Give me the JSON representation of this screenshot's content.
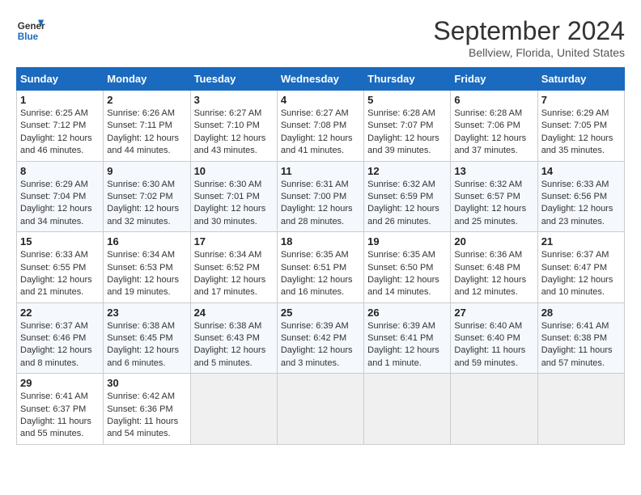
{
  "header": {
    "logo_line1": "General",
    "logo_line2": "Blue",
    "month_title": "September 2024",
    "subtitle": "Bellview, Florida, United States"
  },
  "days_of_week": [
    "Sunday",
    "Monday",
    "Tuesday",
    "Wednesday",
    "Thursday",
    "Friday",
    "Saturday"
  ],
  "weeks": [
    [
      {
        "day": "1",
        "info": "Sunrise: 6:25 AM\nSunset: 7:12 PM\nDaylight: 12 hours and 46 minutes."
      },
      {
        "day": "2",
        "info": "Sunrise: 6:26 AM\nSunset: 7:11 PM\nDaylight: 12 hours and 44 minutes."
      },
      {
        "day": "3",
        "info": "Sunrise: 6:27 AM\nSunset: 7:10 PM\nDaylight: 12 hours and 43 minutes."
      },
      {
        "day": "4",
        "info": "Sunrise: 6:27 AM\nSunset: 7:08 PM\nDaylight: 12 hours and 41 minutes."
      },
      {
        "day": "5",
        "info": "Sunrise: 6:28 AM\nSunset: 7:07 PM\nDaylight: 12 hours and 39 minutes."
      },
      {
        "day": "6",
        "info": "Sunrise: 6:28 AM\nSunset: 7:06 PM\nDaylight: 12 hours and 37 minutes."
      },
      {
        "day": "7",
        "info": "Sunrise: 6:29 AM\nSunset: 7:05 PM\nDaylight: 12 hours and 35 minutes."
      }
    ],
    [
      {
        "day": "8",
        "info": "Sunrise: 6:29 AM\nSunset: 7:04 PM\nDaylight: 12 hours and 34 minutes."
      },
      {
        "day": "9",
        "info": "Sunrise: 6:30 AM\nSunset: 7:02 PM\nDaylight: 12 hours and 32 minutes."
      },
      {
        "day": "10",
        "info": "Sunrise: 6:30 AM\nSunset: 7:01 PM\nDaylight: 12 hours and 30 minutes."
      },
      {
        "day": "11",
        "info": "Sunrise: 6:31 AM\nSunset: 7:00 PM\nDaylight: 12 hours and 28 minutes."
      },
      {
        "day": "12",
        "info": "Sunrise: 6:32 AM\nSunset: 6:59 PM\nDaylight: 12 hours and 26 minutes."
      },
      {
        "day": "13",
        "info": "Sunrise: 6:32 AM\nSunset: 6:57 PM\nDaylight: 12 hours and 25 minutes."
      },
      {
        "day": "14",
        "info": "Sunrise: 6:33 AM\nSunset: 6:56 PM\nDaylight: 12 hours and 23 minutes."
      }
    ],
    [
      {
        "day": "15",
        "info": "Sunrise: 6:33 AM\nSunset: 6:55 PM\nDaylight: 12 hours and 21 minutes."
      },
      {
        "day": "16",
        "info": "Sunrise: 6:34 AM\nSunset: 6:53 PM\nDaylight: 12 hours and 19 minutes."
      },
      {
        "day": "17",
        "info": "Sunrise: 6:34 AM\nSunset: 6:52 PM\nDaylight: 12 hours and 17 minutes."
      },
      {
        "day": "18",
        "info": "Sunrise: 6:35 AM\nSunset: 6:51 PM\nDaylight: 12 hours and 16 minutes."
      },
      {
        "day": "19",
        "info": "Sunrise: 6:35 AM\nSunset: 6:50 PM\nDaylight: 12 hours and 14 minutes."
      },
      {
        "day": "20",
        "info": "Sunrise: 6:36 AM\nSunset: 6:48 PM\nDaylight: 12 hours and 12 minutes."
      },
      {
        "day": "21",
        "info": "Sunrise: 6:37 AM\nSunset: 6:47 PM\nDaylight: 12 hours and 10 minutes."
      }
    ],
    [
      {
        "day": "22",
        "info": "Sunrise: 6:37 AM\nSunset: 6:46 PM\nDaylight: 12 hours and 8 minutes."
      },
      {
        "day": "23",
        "info": "Sunrise: 6:38 AM\nSunset: 6:45 PM\nDaylight: 12 hours and 6 minutes."
      },
      {
        "day": "24",
        "info": "Sunrise: 6:38 AM\nSunset: 6:43 PM\nDaylight: 12 hours and 5 minutes."
      },
      {
        "day": "25",
        "info": "Sunrise: 6:39 AM\nSunset: 6:42 PM\nDaylight: 12 hours and 3 minutes."
      },
      {
        "day": "26",
        "info": "Sunrise: 6:39 AM\nSunset: 6:41 PM\nDaylight: 12 hours and 1 minute."
      },
      {
        "day": "27",
        "info": "Sunrise: 6:40 AM\nSunset: 6:40 PM\nDaylight: 11 hours and 59 minutes."
      },
      {
        "day": "28",
        "info": "Sunrise: 6:41 AM\nSunset: 6:38 PM\nDaylight: 11 hours and 57 minutes."
      }
    ],
    [
      {
        "day": "29",
        "info": "Sunrise: 6:41 AM\nSunset: 6:37 PM\nDaylight: 11 hours and 55 minutes."
      },
      {
        "day": "30",
        "info": "Sunrise: 6:42 AM\nSunset: 6:36 PM\nDaylight: 11 hours and 54 minutes."
      },
      {
        "day": "",
        "info": ""
      },
      {
        "day": "",
        "info": ""
      },
      {
        "day": "",
        "info": ""
      },
      {
        "day": "",
        "info": ""
      },
      {
        "day": "",
        "info": ""
      }
    ]
  ]
}
